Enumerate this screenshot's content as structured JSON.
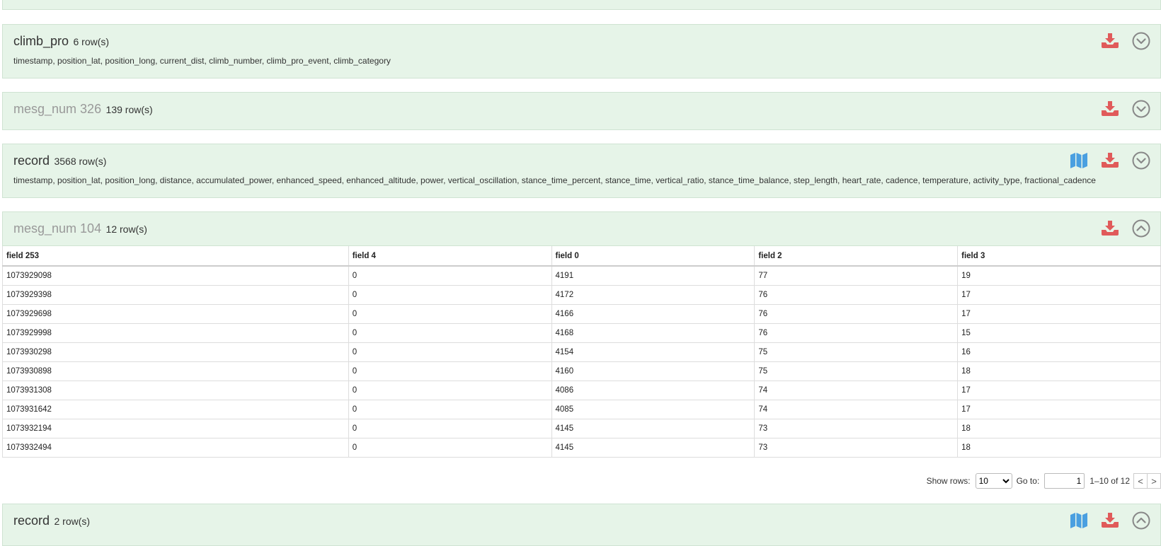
{
  "panels": [
    {
      "name": "climb_pro",
      "count": "6 row(s)",
      "fields": "timestamp, position_lat, position_long, current_dist, climb_number, climb_pro_event, climb_category"
    },
    {
      "name": "mesg_num 326",
      "count": "139 row(s)"
    },
    {
      "name": "record",
      "count": "3568 row(s)",
      "fields": "timestamp, position_lat, position_long, distance, accumulated_power, enhanced_speed, enhanced_altitude, power, vertical_oscillation, stance_time_percent, stance_time, vertical_ratio, stance_time_balance, step_length, heart_rate, cadence, temperature, activity_type, fractional_cadence"
    },
    {
      "name": "mesg_num 104",
      "count": "12 row(s)"
    },
    {
      "name": "record",
      "count": "2 row(s)"
    }
  ],
  "table": {
    "columns": [
      "field 253",
      "field 4",
      "field 0",
      "field 2",
      "field 3"
    ],
    "rows": [
      [
        "1073929098",
        "0",
        "4191",
        "77",
        "19"
      ],
      [
        "1073929398",
        "0",
        "4172",
        "76",
        "17"
      ],
      [
        "1073929698",
        "0",
        "4166",
        "76",
        "17"
      ],
      [
        "1073929998",
        "0",
        "4168",
        "76",
        "15"
      ],
      [
        "1073930298",
        "0",
        "4154",
        "75",
        "16"
      ],
      [
        "1073930898",
        "0",
        "4160",
        "75",
        "18"
      ],
      [
        "1073931308",
        "0",
        "4086",
        "74",
        "17"
      ],
      [
        "1073931642",
        "0",
        "4085",
        "74",
        "17"
      ],
      [
        "1073932194",
        "0",
        "4145",
        "73",
        "18"
      ],
      [
        "1073932494",
        "0",
        "4145",
        "73",
        "18"
      ]
    ]
  },
  "pager": {
    "show_rows_label": "Show rows:",
    "show_rows_value": "10",
    "goto_label": "Go to:",
    "goto_value": "1",
    "range": "1–10 of 12",
    "prev": "<",
    "next": ">"
  },
  "colors": {
    "panel_bg": "#e6f4e8",
    "download_icon": "#e05a5a",
    "map_icon": "#4a9fe0",
    "toggle_icon": "#888888"
  },
  "icons": {
    "download": "download-icon",
    "map": "map-icon",
    "expand": "chevron-down-circle-icon",
    "collapse": "chevron-up-circle-icon"
  }
}
